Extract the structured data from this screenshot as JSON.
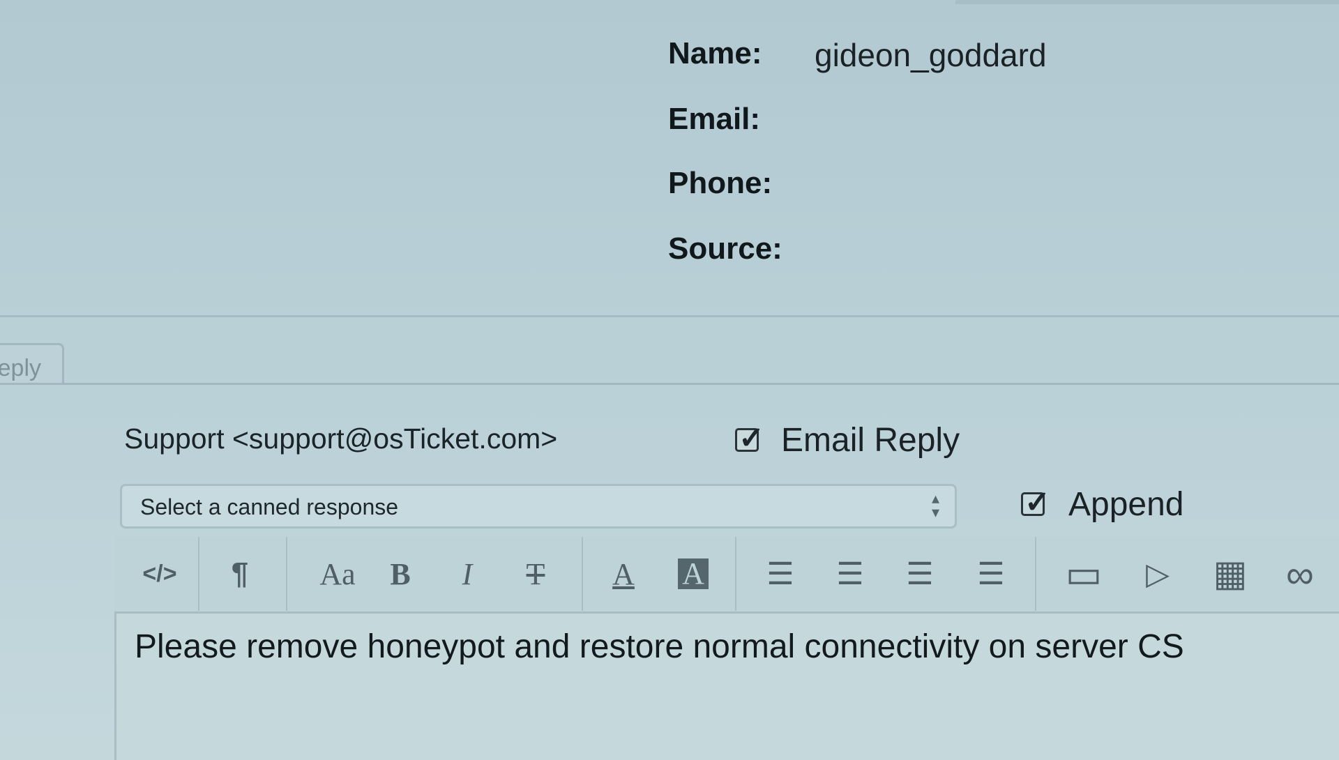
{
  "user_info": {
    "name_label": "Name:",
    "name_value": "gideon_goddard",
    "email_label": "Email:",
    "phone_label": "Phone:",
    "source_label": "Source:"
  },
  "tabs": {
    "reply_label": "eply"
  },
  "reply_form": {
    "from": "Support <support@osTicket.com>",
    "email_reply_label": "Email Reply",
    "email_reply_checked": true,
    "canned_response_placeholder": "Select a canned response",
    "append_label": "Append",
    "append_checked": true
  },
  "toolbar": {
    "buttons": [
      {
        "name": "html-source-icon",
        "glyph": "</>"
      },
      {
        "name": "paragraph-icon",
        "glyph": "¶"
      },
      {
        "name": "font-size-icon",
        "glyph": "Aa"
      },
      {
        "name": "bold-icon",
        "glyph": "B"
      },
      {
        "name": "italic-icon",
        "glyph": "I"
      },
      {
        "name": "strikethrough-icon",
        "glyph": "T"
      },
      {
        "name": "font-color-icon",
        "glyph": "A"
      },
      {
        "name": "background-color-icon",
        "glyph": "A"
      },
      {
        "name": "unordered-list-icon",
        "glyph": "☰"
      },
      {
        "name": "ordered-list-icon",
        "glyph": "☰"
      },
      {
        "name": "outdent-icon",
        "glyph": "☰"
      },
      {
        "name": "indent-icon",
        "glyph": "☰"
      },
      {
        "name": "image-icon",
        "glyph": "▭"
      },
      {
        "name": "video-icon",
        "glyph": "▷"
      },
      {
        "name": "table-icon",
        "glyph": "▦"
      },
      {
        "name": "link-icon",
        "glyph": "∞"
      }
    ]
  },
  "editor": {
    "body": "Please remove honeypot and restore normal connectivity on server CS"
  },
  "colors": {
    "background": "#b5ccd4",
    "text": "#1a2226",
    "border": "#a9bec4"
  }
}
